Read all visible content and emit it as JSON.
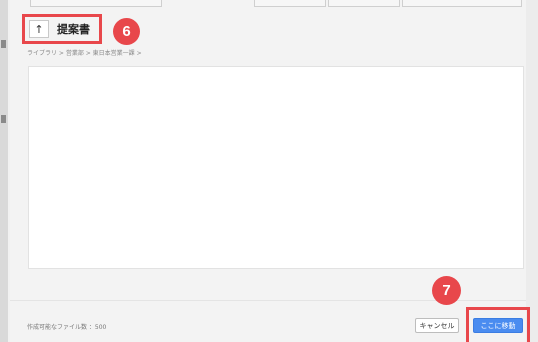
{
  "header": {
    "up_icon": "arrow-up-icon",
    "up_glyph": "↑",
    "folder_title": "提案書"
  },
  "breadcrumb": "ライブラリ > 営業部 > 東日本営業一課 >",
  "annotations": {
    "step6": "6",
    "step7": "7",
    "color": "#e8474b"
  },
  "footer": {
    "file_count": "作成可能なファイル数 ：500",
    "cancel_label": "キャンセル",
    "move_label": "ここに移動"
  },
  "colors": {
    "primary_button": "#4a8cf0",
    "background": "#f1f1f1"
  }
}
